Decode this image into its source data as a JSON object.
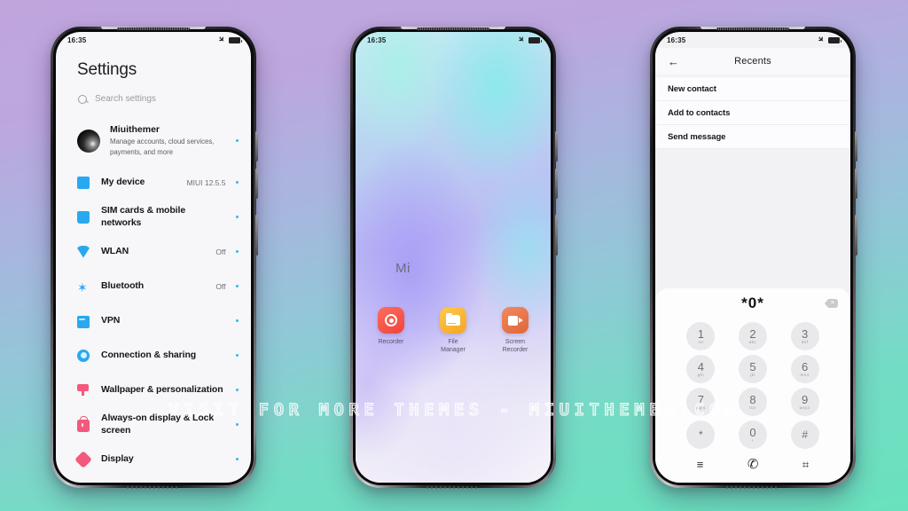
{
  "background": {
    "top_color": "#c0a5dd",
    "bottom_color": "#68e2bd"
  },
  "watermark": {
    "text": "VISIT FOR MORE THEMES - MIUITHEMER.COM"
  },
  "status_bar": {
    "time": "16:35",
    "airplane_icon": "airplane-mode-icon",
    "battery_icon": "battery-full-icon"
  },
  "phone_settings": {
    "title": "Settings",
    "search": {
      "placeholder": "Search settings",
      "icon": "search-icon"
    },
    "account": {
      "name": "Miuithemer",
      "subtitle": "Manage accounts, cloud services, payments, and more",
      "avatar": "user-avatar"
    },
    "items": [
      {
        "label": "My device",
        "value": "MIUI 12.5.5",
        "icon": "device-icon",
        "color": "#2aa8ef"
      },
      {
        "label": "SIM cards & mobile networks",
        "value": "",
        "icon": "sim-card-icon",
        "color": "#2aa8ef"
      },
      {
        "label": "WLAN",
        "value": "Off",
        "icon": "wifi-icon",
        "color": "#2aa8ef"
      },
      {
        "label": "Bluetooth",
        "value": "Off",
        "icon": "bluetooth-icon",
        "color": "#2aa8ef"
      },
      {
        "label": "VPN",
        "value": "",
        "icon": "vpn-icon",
        "color": "#2aa8ef"
      },
      {
        "label": "Connection & sharing",
        "value": "",
        "icon": "connection-icon",
        "color": "#2aa8ef"
      },
      {
        "label": "Wallpaper & personalization",
        "value": "",
        "icon": "wallpaper-icon",
        "color": "#f2597c"
      },
      {
        "label": "Always-on display & Lock screen",
        "value": "",
        "icon": "lock-icon",
        "color": "#f2597c"
      },
      {
        "label": "Display",
        "value": "",
        "icon": "display-icon",
        "color": "#f2597c"
      }
    ]
  },
  "phone_home": {
    "widget_label": "Mi",
    "apps": [
      {
        "name": "Recorder",
        "icon": "recorder-icon"
      },
      {
        "name": "File\nManager",
        "icon": "file-manager-icon"
      },
      {
        "name": "Screen\nRecorder",
        "icon": "screen-recorder-icon"
      }
    ]
  },
  "phone_dialer": {
    "header": {
      "title": "Recents",
      "back_icon": "back-arrow-icon"
    },
    "options": [
      {
        "label": "New contact"
      },
      {
        "label": "Add to contacts"
      },
      {
        "label": "Send message"
      }
    ],
    "number_display": "*0*",
    "backspace_icon": "backspace-icon",
    "keys": [
      {
        "digit": "1",
        "letters": "oo"
      },
      {
        "digit": "2",
        "letters": "abc"
      },
      {
        "digit": "3",
        "letters": "def"
      },
      {
        "digit": "4",
        "letters": "ghi"
      },
      {
        "digit": "5",
        "letters": "jkl"
      },
      {
        "digit": "6",
        "letters": "mno"
      },
      {
        "digit": "7",
        "letters": "pqrs"
      },
      {
        "digit": "8",
        "letters": "tuv"
      },
      {
        "digit": "9",
        "letters": "wxyz"
      },
      {
        "digit": "*",
        "letters": ""
      },
      {
        "digit": "0",
        "letters": "+"
      },
      {
        "digit": "#",
        "letters": ""
      }
    ],
    "bottom_bar": [
      {
        "icon": "menu-icon",
        "glyph": "≡"
      },
      {
        "icon": "call-icon",
        "glyph": "✆"
      },
      {
        "icon": "keypad-icon",
        "glyph": "⌗"
      }
    ]
  }
}
